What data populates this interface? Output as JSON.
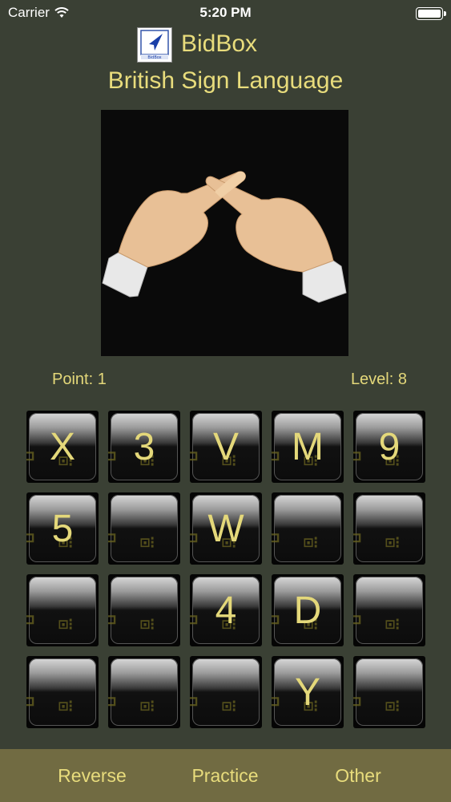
{
  "status_bar": {
    "carrier": "Carrier",
    "time": "5:20 PM"
  },
  "header": {
    "app_name": "BidBox",
    "logo_text": "BidBox",
    "subtitle": "British Sign Language"
  },
  "score": {
    "points": "Point: 1",
    "level": "Level: 8"
  },
  "tiles": [
    "X",
    "3",
    "V",
    "M",
    "9",
    "5",
    "",
    "W",
    "",
    "",
    "",
    "",
    "4",
    "D",
    "",
    "",
    "",
    "",
    "Y",
    ""
  ],
  "tabs": {
    "reverse": "Reverse",
    "practice": "Practice",
    "other": "Other"
  },
  "colors": {
    "background": "#3a4034",
    "accent_text": "#e4d87a",
    "tab_bar": "#716b42"
  }
}
